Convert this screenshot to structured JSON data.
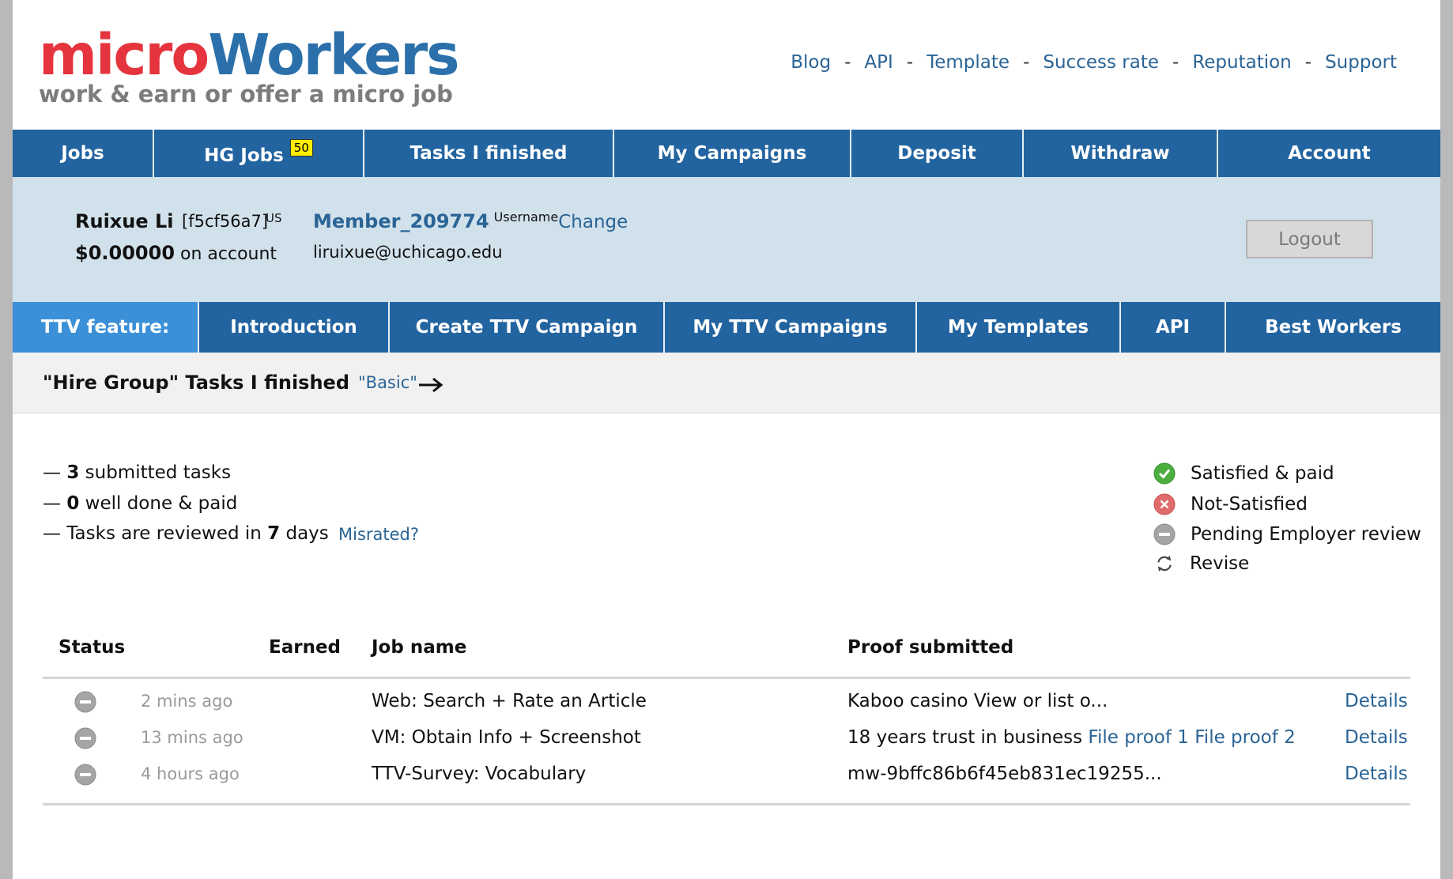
{
  "header": {
    "logo": {
      "micro": "micro",
      "workers": "Workers",
      "tagline": "work & earn or offer a micro job"
    },
    "top_links": [
      "Blog",
      "API",
      "Template",
      "Success rate",
      "Reputation",
      "Support"
    ],
    "separator": "-"
  },
  "main_nav": [
    {
      "label": "Jobs"
    },
    {
      "label": "HG Jobs",
      "badge": "50"
    },
    {
      "label": "Tasks I finished"
    },
    {
      "label": "My Campaigns"
    },
    {
      "label": "Deposit"
    },
    {
      "label": "Withdraw"
    },
    {
      "label": "Account"
    }
  ],
  "user": {
    "name": "Ruixue Li",
    "id": "[f5cf56a7]",
    "country": "US",
    "balance": "$0.00000",
    "balance_suffix": "on account",
    "username": "Member_209774",
    "username_label": "Username",
    "change_label": "Change",
    "email": "liruixue@uchicago.edu",
    "logout_label": "Logout"
  },
  "ttv_nav": {
    "label": "TTV feature:",
    "items": [
      "Introduction",
      "Create TTV Campaign",
      "My TTV Campaigns",
      "My Templates",
      "API",
      "Best Workers"
    ]
  },
  "sub_header": {
    "title": "\"Hire Group\" Tasks I finished",
    "basic_link": "\"Basic\""
  },
  "stats": {
    "dash": "—",
    "submitted_count": "3",
    "submitted_text": "submitted tasks",
    "paid_count": "0",
    "paid_text": "well done & paid",
    "review_prefix": "Tasks are reviewed in",
    "review_days": "7",
    "review_suffix": "days",
    "misrated": "Misrated?"
  },
  "legend": [
    {
      "icon": "check-circle-icon",
      "label": "Satisfied & paid",
      "color": "#4cae3f"
    },
    {
      "icon": "x-circle-icon",
      "label": "Not-Satisfied",
      "color": "#d9534f"
    },
    {
      "icon": "pending-circle-icon",
      "label": "Pending Employer review",
      "color": "#9a9a9a"
    },
    {
      "icon": "revise-icon",
      "label": "Revise",
      "color": "#555555"
    }
  ],
  "table": {
    "headers": {
      "status": "Status",
      "earned": "Earned",
      "job_name": "Job name",
      "proof": "Proof submitted"
    },
    "rows": [
      {
        "status_icon": "pending-circle-icon",
        "time": "2 mins ago",
        "earned": "",
        "job": "Web: Search + Rate an Article",
        "proof": "Kaboo casino View or list o...",
        "proof_links": [],
        "details": "Details"
      },
      {
        "status_icon": "pending-circle-icon",
        "time": "13 mins ago",
        "earned": "",
        "job": "VM: Obtain Info + Screenshot",
        "proof": "18 years trust in business",
        "proof_links": [
          "File proof 1",
          "File proof 2"
        ],
        "details": "Details"
      },
      {
        "status_icon": "pending-circle-icon",
        "time": "4 hours ago",
        "earned": "",
        "job": "TTV-Survey: Vocabulary",
        "proof": "mw-9bffc86b6f45eb831ec19255...",
        "proof_links": [],
        "details": "Details"
      }
    ]
  }
}
